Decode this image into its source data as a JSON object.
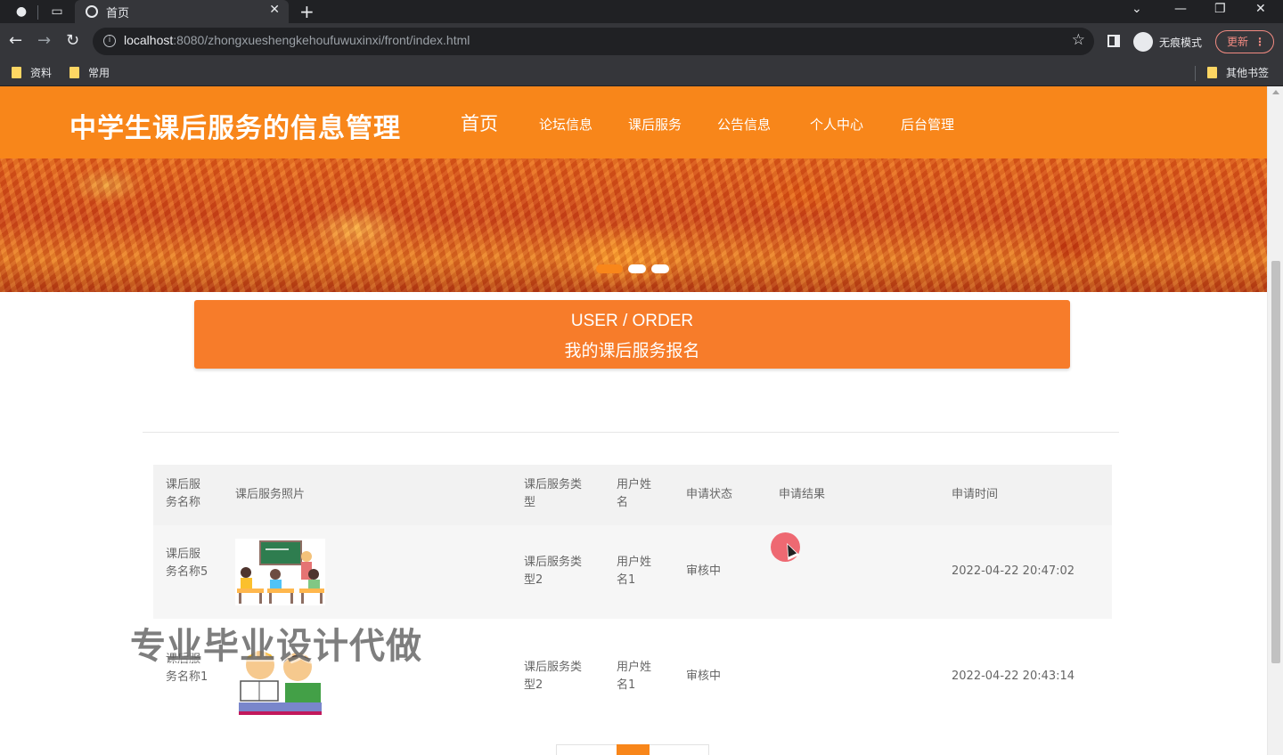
{
  "browser": {
    "tab_title": "首页",
    "url_host": "localhost",
    "url_rest": ":8080/zhongxueshengkehoufuwuxinxi/front/index.html",
    "incognito_label": "无痕模式",
    "update_label": "更新",
    "bookmarks": [
      "资料",
      "常用"
    ],
    "other_bookmarks": "其他书签"
  },
  "header": {
    "site_title": "中学生课后服务的信息管理",
    "menu": [
      "首页",
      "论坛信息",
      "课后服务",
      "公告信息",
      "个人中心",
      "后台管理"
    ],
    "active_menu": "首页"
  },
  "carousel": {
    "slide_count": 3,
    "active_index": 0
  },
  "order_banner": {
    "title_en": "USER / ORDER",
    "title_cn": "我的课后服务报名"
  },
  "table": {
    "headers": [
      "课后服务名称",
      "课后服务照片",
      "课后服务类型",
      "用户姓名",
      "申请状态",
      "申请结果",
      "申请时间"
    ],
    "rows": [
      {
        "name": "课后服务名称5",
        "photo": "classroom-illustration",
        "type": "课后服务类型2",
        "user": "用户姓名1",
        "status": "审核中",
        "result": "",
        "time": "2022-04-22 20:47:02"
      },
      {
        "name": "课后服务名称1",
        "photo": "students-reading-illustration",
        "type": "课后服务类型2",
        "user": "用户姓名1",
        "status": "审核中",
        "result": "",
        "time": "2022-04-22 20:43:14"
      }
    ]
  },
  "watermark": "专业毕业设计代做",
  "colors": {
    "accent": "#f8861a",
    "banner_orange": "#f77c2a",
    "chrome_dark": "#202124"
  }
}
